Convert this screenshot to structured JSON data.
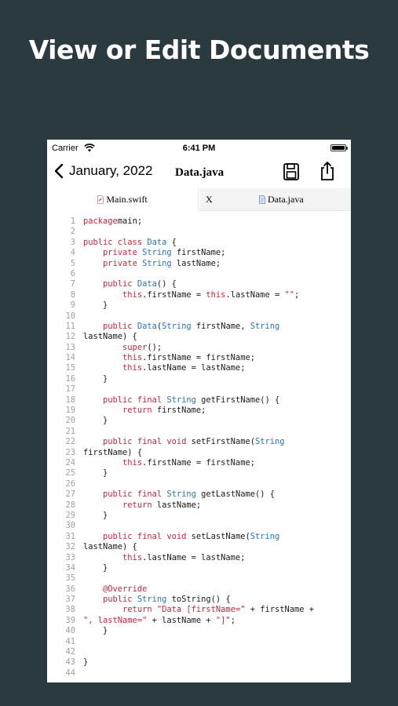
{
  "headline": "View or Edit Documents",
  "status_bar": {
    "carrier": "Carrier",
    "time": "6:41 PM"
  },
  "nav": {
    "back_label": "January, 2022",
    "title": "Data.java"
  },
  "tabs": [
    {
      "label": "Main.swift"
    },
    {
      "close": "X",
      "label": "Data.java"
    }
  ],
  "colors": {
    "background": "#2b3a3f",
    "keyword": "#c8283c",
    "type": "#2a73b8",
    "line_number": "#a0a0a0"
  },
  "code_lines": [
    {
      "n": "1",
      "parts": [
        [
          "kw",
          "package"
        ],
        [
          "",
          "main;"
        ]
      ]
    },
    {
      "n": "2",
      "parts": []
    },
    {
      "n": "3",
      "parts": [
        [
          "kw",
          "public class "
        ],
        [
          "ty",
          "Data"
        ],
        [
          "",
          " {"
        ]
      ]
    },
    {
      "n": "4",
      "parts": [
        [
          "",
          " "
        ],
        [
          "kw",
          "private "
        ],
        [
          "ty",
          "String"
        ],
        [
          "",
          " firstName;"
        ]
      ]
    },
    {
      "n": "5",
      "parts": [
        [
          "",
          " "
        ],
        [
          "kw",
          "private "
        ],
        [
          "ty",
          "String"
        ],
        [
          "",
          " lastName;"
        ]
      ]
    },
    {
      "n": "6",
      "parts": []
    },
    {
      "n": "7",
      "parts": [
        [
          "",
          " "
        ],
        [
          "kw",
          "public "
        ],
        [
          "ty",
          "Data"
        ],
        [
          "",
          "() {"
        ]
      ]
    },
    {
      "n": "8",
      "parts": [
        [
          "",
          " "
        ],
        [
          "kw",
          "this"
        ],
        [
          "",
          ".firstName = "
        ],
        [
          "kw",
          "this"
        ],
        [
          "",
          ".lastName = "
        ],
        [
          "st",
          "\"\""
        ],
        [
          "",
          ";"
        ]
      ]
    },
    {
      "n": "9",
      "parts": [
        [
          "",
          " }"
        ]
      ]
    },
    {
      "n": "10",
      "parts": []
    },
    {
      "n": "11",
      "parts": [
        [
          "",
          " "
        ],
        [
          "kw",
          "public "
        ],
        [
          "ty",
          "Data"
        ],
        [
          "",
          "("
        ],
        [
          "ty",
          "String"
        ],
        [
          "",
          " firstName, "
        ],
        [
          "ty",
          "String"
        ]
      ]
    },
    {
      "n": "12",
      "parts": [
        [
          "",
          "lastName) {"
        ]
      ]
    },
    {
      "n": "13",
      "parts": [
        [
          "",
          " "
        ],
        [
          "kw",
          "super"
        ],
        [
          "",
          "();"
        ]
      ]
    },
    {
      "n": "14",
      "parts": [
        [
          "",
          " "
        ],
        [
          "kw",
          "this"
        ],
        [
          "",
          ".firstName = firstName;"
        ]
      ]
    },
    {
      "n": "15",
      "parts": [
        [
          "",
          " "
        ],
        [
          "kw",
          "this"
        ],
        [
          "",
          ".lastName = lastName;"
        ]
      ]
    },
    {
      "n": "16",
      "parts": [
        [
          "",
          " }"
        ]
      ]
    },
    {
      "n": "17",
      "parts": []
    },
    {
      "n": "18",
      "parts": [
        [
          "",
          " "
        ],
        [
          "kw",
          "public final "
        ],
        [
          "ty",
          "String"
        ],
        [
          "",
          " getFirstName() {"
        ]
      ]
    },
    {
      "n": "19",
      "parts": [
        [
          "",
          " "
        ],
        [
          "kw",
          "return"
        ],
        [
          "",
          " firstName;"
        ]
      ]
    },
    {
      "n": "20",
      "parts": [
        [
          "",
          " }"
        ]
      ]
    },
    {
      "n": "21",
      "parts": []
    },
    {
      "n": "22",
      "parts": [
        [
          "",
          " "
        ],
        [
          "kw",
          "public final void"
        ],
        [
          "",
          " setFirstName("
        ],
        [
          "ty",
          "String"
        ]
      ]
    },
    {
      "n": "23",
      "parts": [
        [
          "",
          "firstName) {"
        ]
      ]
    },
    {
      "n": "24",
      "parts": [
        [
          "",
          " "
        ],
        [
          "kw",
          "this"
        ],
        [
          "",
          ".firstName = firstName;"
        ]
      ]
    },
    {
      "n": "25",
      "parts": [
        [
          "",
          " }"
        ]
      ]
    },
    {
      "n": "26",
      "parts": []
    },
    {
      "n": "27",
      "parts": [
        [
          "",
          " "
        ],
        [
          "kw",
          "public final "
        ],
        [
          "ty",
          "String"
        ],
        [
          "",
          " getLastName() {"
        ]
      ]
    },
    {
      "n": "28",
      "parts": [
        [
          "",
          " "
        ],
        [
          "kw",
          "return"
        ],
        [
          "",
          " lastName;"
        ]
      ]
    },
    {
      "n": "29",
      "parts": [
        [
          "",
          " }"
        ]
      ]
    },
    {
      "n": "30",
      "parts": []
    },
    {
      "n": "31",
      "parts": [
        [
          "",
          " "
        ],
        [
          "kw",
          "public final void"
        ],
        [
          "",
          " setLastName("
        ],
        [
          "ty",
          "String"
        ]
      ]
    },
    {
      "n": "32",
      "parts": [
        [
          "",
          "lastName) {"
        ]
      ]
    },
    {
      "n": "33",
      "parts": [
        [
          "",
          " "
        ],
        [
          "kw",
          "this"
        ],
        [
          "",
          ".lastName = lastName;"
        ]
      ]
    },
    {
      "n": "34",
      "parts": [
        [
          "",
          " }"
        ]
      ]
    },
    {
      "n": "35",
      "parts": []
    },
    {
      "n": "36",
      "parts": [
        [
          "",
          " "
        ],
        [
          "an",
          "@Override"
        ]
      ]
    },
    {
      "n": "37",
      "parts": [
        [
          "",
          " "
        ],
        [
          "kw",
          "public "
        ],
        [
          "ty",
          "String"
        ],
        [
          "",
          " toString() {"
        ]
      ]
    },
    {
      "n": "38",
      "parts": [
        [
          "",
          " "
        ],
        [
          "kw",
          "return "
        ],
        [
          "st",
          "\"Data [firstName=\""
        ],
        [
          "",
          " + firstName +"
        ]
      ]
    },
    {
      "n": "39",
      "parts": [
        [
          "st",
          "\", lastName=\""
        ],
        [
          "",
          " + lastName + "
        ],
        [
          "st",
          "\"]\""
        ],
        [
          "",
          ";"
        ]
      ]
    },
    {
      "n": "40",
      "parts": [
        [
          "",
          " }"
        ]
      ]
    },
    {
      "n": "41",
      "parts": []
    },
    {
      "n": "42",
      "parts": []
    },
    {
      "n": "43",
      "parts": [
        [
          "",
          "}"
        ]
      ]
    },
    {
      "n": "44",
      "parts": []
    }
  ]
}
